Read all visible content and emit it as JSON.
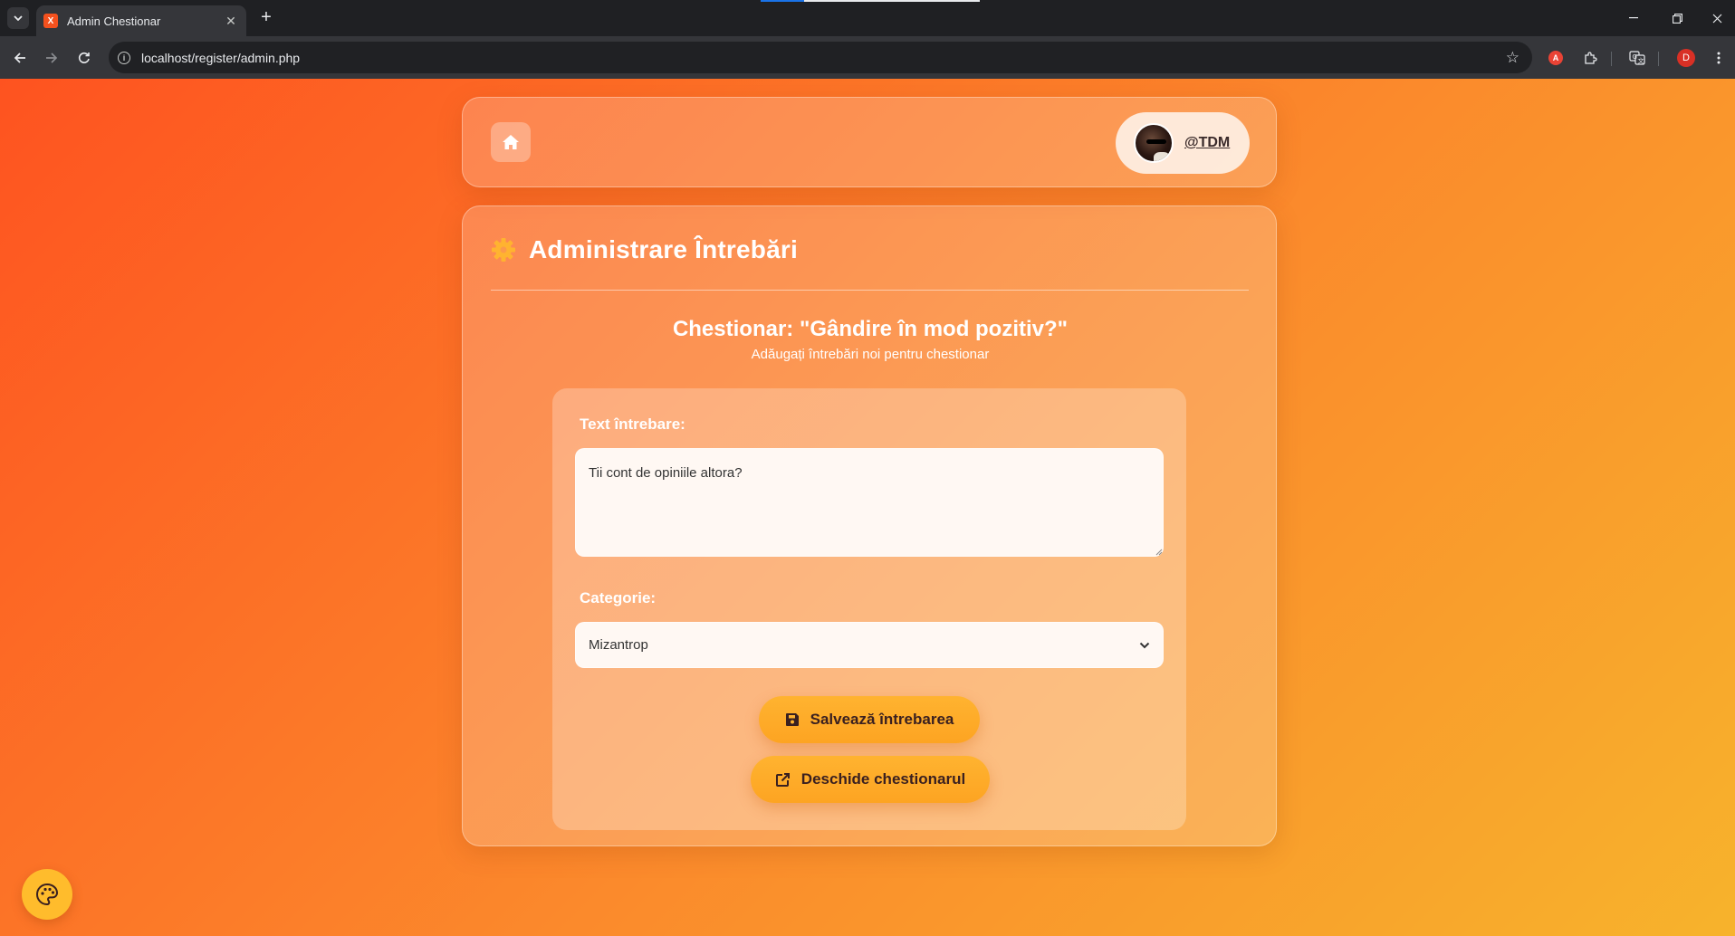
{
  "browser": {
    "tab_title": "Admin Chestionar",
    "favicon_letter": "X",
    "url": "localhost/register/admin.php",
    "profile_initial": "D",
    "extension_letter": "A"
  },
  "header": {
    "home_icon": "home-icon",
    "username": "@TDM"
  },
  "admin": {
    "title": "Administrare Întrebări",
    "title_icon": "gear-icon",
    "quiz_title": "Chestionar: \"Gândire în mod pozitiv?\"",
    "quiz_subtitle": "Adăugați întrebări noi pentru chestionar"
  },
  "form": {
    "question_label": "Text întrebare:",
    "question_value": "Tii cont de opiniile altora?",
    "category_label": "Categorie:",
    "category_selected": "Mizantrop",
    "save_label": "Salvează întrebarea",
    "open_label": "Deschide chestionarul"
  },
  "colors": {
    "gradient_start": "#fe5320",
    "gradient_end": "#f7b32c",
    "button": "#ffb330",
    "gear": "#ffb330"
  }
}
